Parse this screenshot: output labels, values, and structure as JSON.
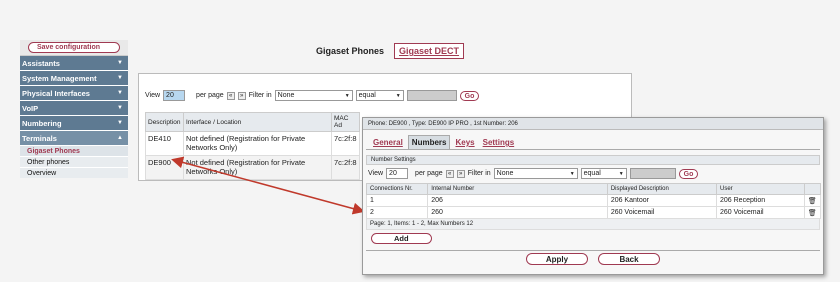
{
  "sidebar": {
    "save_label": "Save configuration",
    "menu": [
      {
        "label": "Assistants"
      },
      {
        "label": "System Management"
      },
      {
        "label": "Physical Interfaces"
      },
      {
        "label": "VoIP"
      },
      {
        "label": "Numbering"
      },
      {
        "label": "Terminals"
      }
    ],
    "submenu": [
      {
        "label": "Gigaset Phones"
      },
      {
        "label": "Other phones"
      },
      {
        "label": "Overview"
      }
    ]
  },
  "top_tabs": {
    "current": "Gigaset Phones",
    "other": "Gigaset DECT"
  },
  "bg_list": {
    "view_label": "View",
    "view_value": "20",
    "per_page_label": "per page",
    "filter_label": "Filter in",
    "filter_field": "None",
    "filter_op": "equal",
    "go_label": "Go",
    "headers": [
      "Description",
      "Interface / Location",
      "MAC Ad"
    ],
    "rows": [
      {
        "desc": "DE410",
        "iface": "Not defined (Registration for Private Networks Only)",
        "mac": "7c:2f:8"
      },
      {
        "desc": "DE900",
        "iface": "Not defined (Registration for Private Networks Only)",
        "mac": "7c:2f:8"
      }
    ]
  },
  "phone_dialog": {
    "header": "Phone: DE900 , Type: DE900 IP PRO , 1st Number: 206",
    "tabs": [
      "General",
      "Numbers",
      "Keys",
      "Settings"
    ],
    "section_title": "Number Settings",
    "view_label": "View",
    "view_value": "20",
    "per_page_label": "per page",
    "filter_label": "Filter in",
    "filter_field": "None",
    "filter_op": "equal",
    "go_label": "Go",
    "headers": [
      "Connections Nr.",
      "Internal Number",
      "Displayed Description",
      "User"
    ],
    "rows": [
      {
        "nr": "1",
        "internal": "206",
        "desc": "206 Kantoor",
        "user": "206 Reception"
      },
      {
        "nr": "2",
        "internal": "260",
        "desc": "260 Voicemail",
        "user": "260 Voicemail"
      }
    ],
    "pagination": "Page:  1, Items:  1 - 2, Max Numbers 12",
    "add_label": "Add",
    "apply_label": "Apply",
    "back_label": "Back"
  },
  "colors": {
    "accent": "#a03a52",
    "menu_bg": "#5e7a92",
    "arrow": "#c0392b"
  }
}
